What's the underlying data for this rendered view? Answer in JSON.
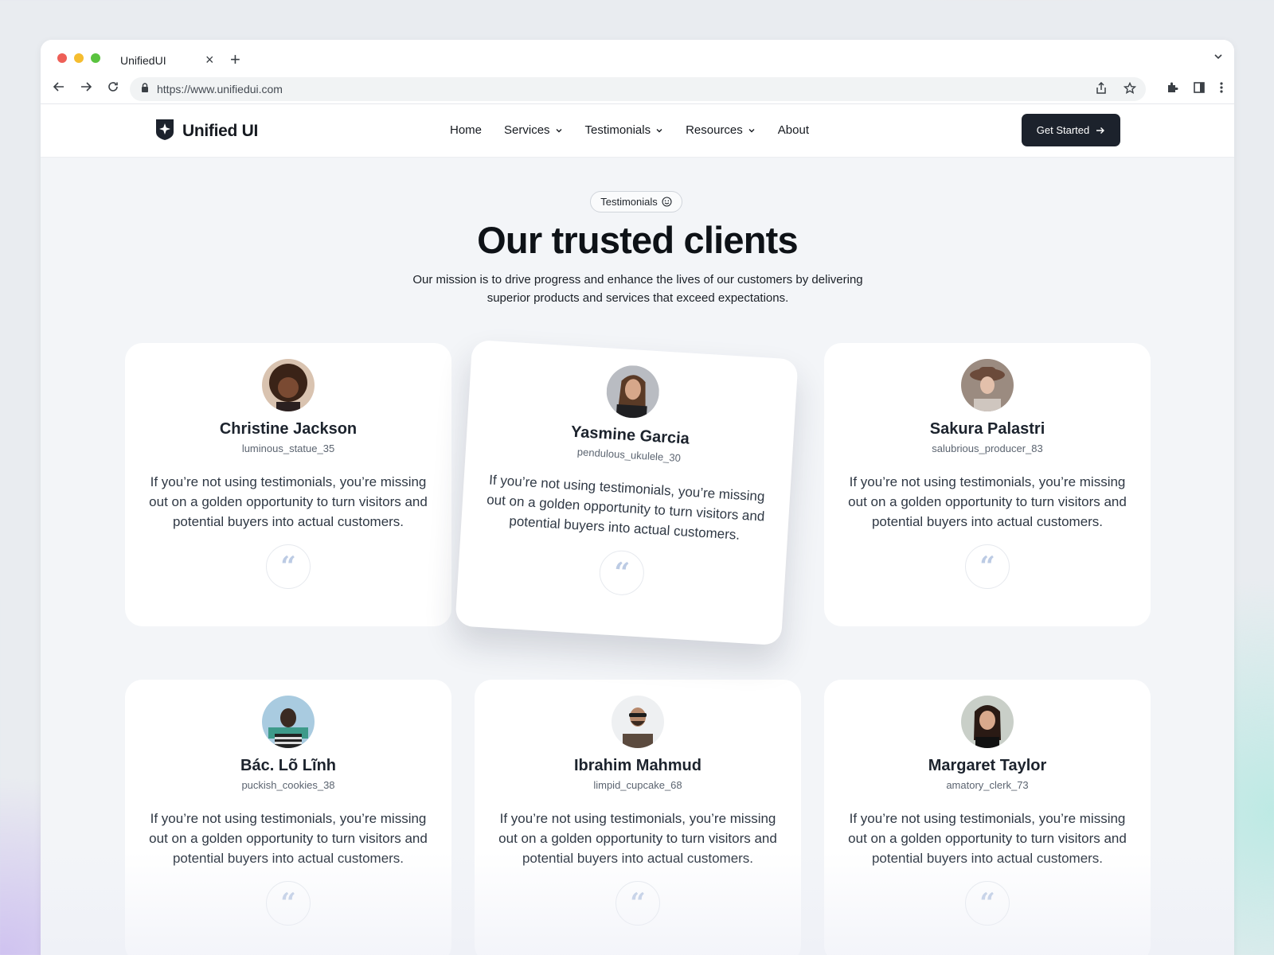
{
  "browser": {
    "tab_title": "UnifiedUI",
    "url": "https://www.unifiedui.com"
  },
  "header": {
    "logo_text": "Unified UI",
    "nav": [
      {
        "label": "Home"
      },
      {
        "label": "Services"
      },
      {
        "label": "Testimonials"
      },
      {
        "label": "Resources"
      },
      {
        "label": "About"
      }
    ],
    "cta_label": "Get Started"
  },
  "hero": {
    "pill_label": "Testimonials",
    "title": "Our trusted clients",
    "subtitle_line1": "Our mission is to drive progress and enhance the lives of our customers by delivering",
    "subtitle_line2": "superior products and services that exceed expectations."
  },
  "testimonials": [
    {
      "name": "Christine Jackson",
      "handle": "luminous_statue_35",
      "quote": "If you’re not using testimonials, you’re missing out on a golden opportunity to turn visitors and potential buyers into actual customers."
    },
    {
      "name": "Yasmine Garcia",
      "handle": "pendulous_ukulele_30",
      "quote": "If you’re not using testimonials, you’re missing out on a golden opportunity to turn visitors and potential buyers into actual customers."
    },
    {
      "name": "Sakura Palastri",
      "handle": "salubrious_producer_83",
      "quote": "If you’re not using testimonials, you’re missing out on a golden opportunity to turn visitors and potential buyers into actual customers."
    },
    {
      "name": "Bác. Lõ Lĩnh",
      "handle": "puckish_cookies_38",
      "quote": "If you’re not using testimonials, you’re missing out on a golden opportunity to turn visitors and potential buyers into actual customers."
    },
    {
      "name": "Ibrahim Mahmud",
      "handle": "limpid_cupcake_68",
      "quote": "If you’re not using testimonials, you’re missing out on a golden opportunity to turn visitors and potential buyers into actual customers."
    },
    {
      "name": "Margaret Taylor",
      "handle": "amatory_clerk_73",
      "quote": "If you’re not using testimonials, you’re missing out on a golden opportunity to turn visitors and potential buyers into actual customers."
    }
  ],
  "quote_mark": "“",
  "colors": {
    "accent_dark": "#1c222c",
    "quote_icon": "#bccbe4",
    "traffic_red": "#ee5f57",
    "traffic_yellow": "#f5bd2f",
    "traffic_green": "#5ac33f"
  },
  "icons": [
    "back-icon",
    "forward-icon",
    "reload-icon",
    "lock-icon",
    "share-icon",
    "star-icon",
    "extensions-icon",
    "sidepanel-icon",
    "more-icon",
    "chevron-down-icon",
    "arrow-right-icon",
    "smile-icon",
    "quote-icon"
  ]
}
